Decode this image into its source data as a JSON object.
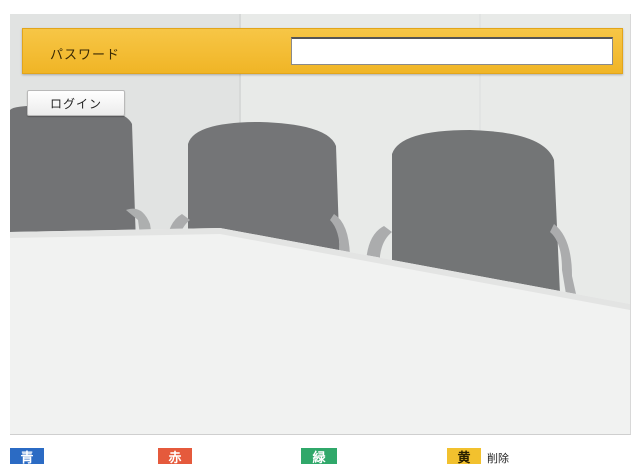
{
  "login_form": {
    "password_label": "パスワード",
    "password_value": "",
    "login_button_label": "ログイン"
  },
  "color_keys": {
    "blue": {
      "label": "青"
    },
    "red": {
      "label": "赤"
    },
    "green": {
      "label": "緑"
    },
    "yellow": {
      "label": "黄",
      "caption": "削除"
    }
  },
  "colors": {
    "password_bar": "#f2b82c",
    "blue_key": "#2b6bc4",
    "red_key": "#e55a3c",
    "green_key": "#30a86a",
    "yellow_key": "#f2c12e"
  }
}
